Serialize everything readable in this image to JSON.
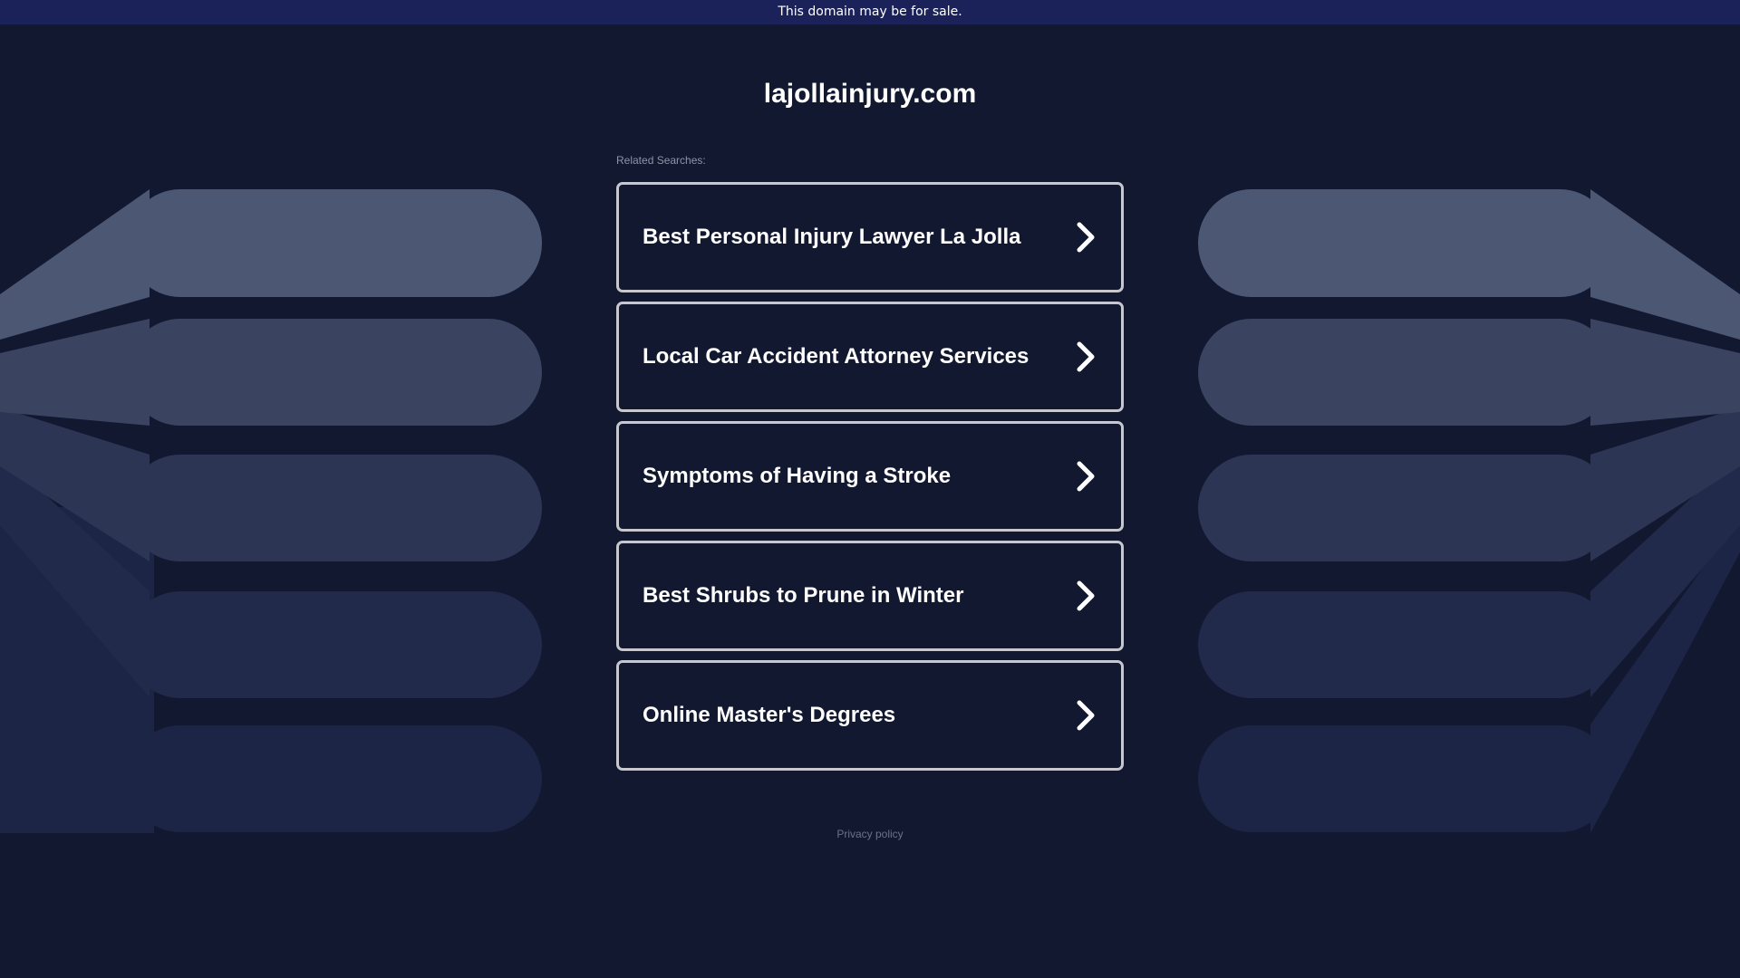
{
  "banner": {
    "text": "This domain may be for sale."
  },
  "domain": {
    "title": "lajollainjury.com"
  },
  "related": {
    "label": "Related Searches:",
    "items": [
      {
        "label": "Best Personal Injury Lawyer La Jolla"
      },
      {
        "label": "Local Car Accident Attorney Services"
      },
      {
        "label": "Symptoms of Having a Stroke"
      },
      {
        "label": "Best Shrubs to Prune in Winter"
      },
      {
        "label": "Online Master's Degrees"
      }
    ]
  },
  "footer": {
    "privacy_label": "Privacy policy"
  },
  "colors": {
    "background": "#111830",
    "banner": "#1b2159",
    "link_border": "#c6c8cd",
    "shape_tones": [
      "#4c5774",
      "#3a4461",
      "#2c3654",
      "#212a4a",
      "#1c2545"
    ]
  },
  "icons": {
    "link_arrow": "chevron-right-icon"
  }
}
